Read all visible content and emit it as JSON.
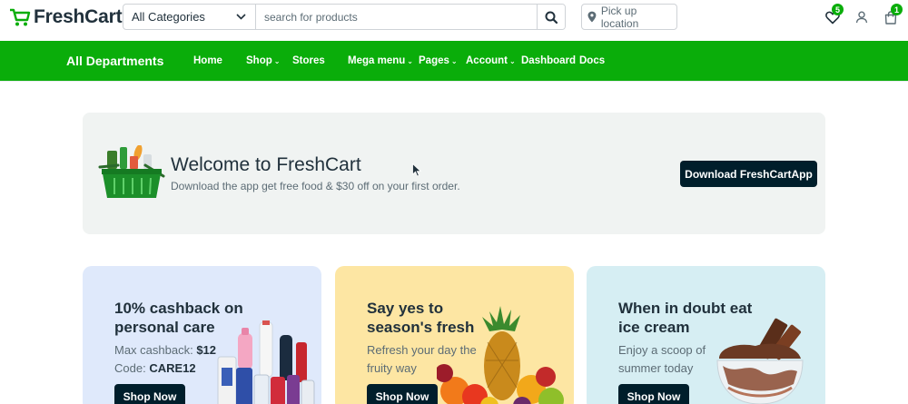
{
  "brand": {
    "name": "FreshCart",
    "accent": "#0aad0a",
    "dark": "#001e2b"
  },
  "header": {
    "category_select": "All Categories",
    "search_placeholder": "search for products",
    "location_label": "Pick up location",
    "wishlist_count": "5",
    "cart_count": "1"
  },
  "nav": {
    "all_departments": "All Departments",
    "items": [
      {
        "label": "Home",
        "dropdown": false
      },
      {
        "label": "Shop",
        "dropdown": true
      },
      {
        "label": "Stores",
        "dropdown": false
      },
      {
        "label": "Mega menu",
        "dropdown": true
      },
      {
        "label": "Pages",
        "dropdown": true
      },
      {
        "label": "Account",
        "dropdown": true
      },
      {
        "label": "Dashboard",
        "dropdown": false
      },
      {
        "label": "Docs",
        "dropdown": false
      }
    ]
  },
  "welcome": {
    "title": "Welcome to FreshCart",
    "subtitle": "Download the app get free food & $30 off on your first order.",
    "button": "Download FreshCartApp"
  },
  "promos": [
    {
      "title": "10% cashback on personal care",
      "desc_line1_label": "Max cashback:",
      "desc_line1_value": "$12",
      "desc_line2_label": "Code:",
      "desc_line2_value": "CARE12",
      "button": "Shop Now",
      "bg": "#dfe9fb"
    },
    {
      "title": "Say yes to season's fresh",
      "desc": "Refresh your day the fruity way",
      "button": "Shop Now",
      "bg": "#fde6a3"
    },
    {
      "title": "When in doubt eat ice cream",
      "desc": "Enjoy a scoop of summer today",
      "button": "Shop Now",
      "bg": "#d6eef3"
    }
  ]
}
